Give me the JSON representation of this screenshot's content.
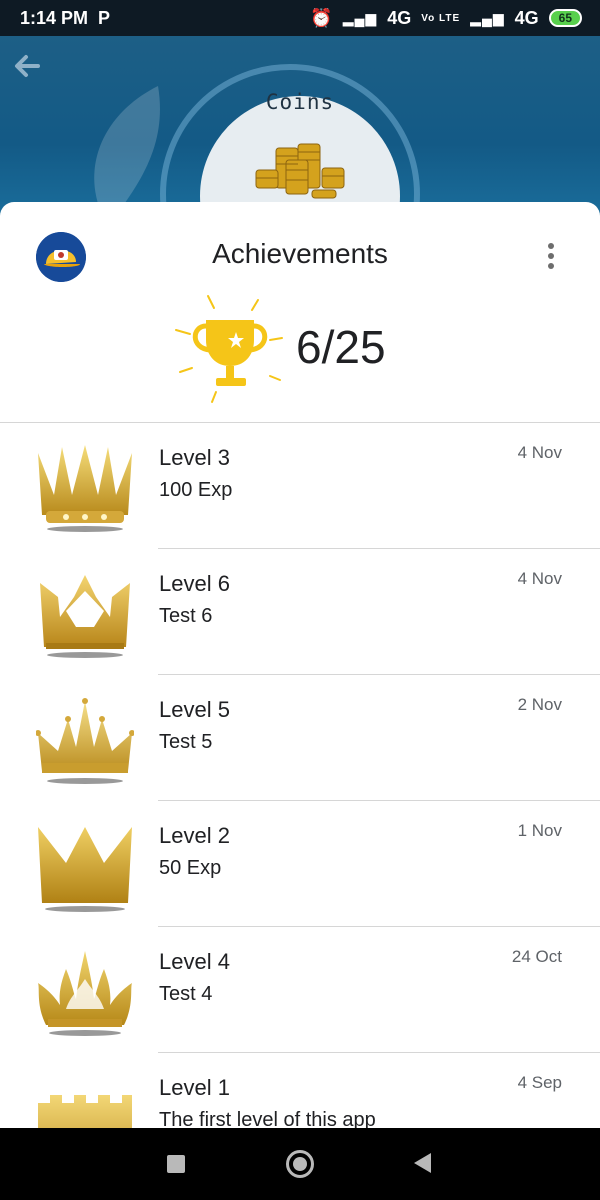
{
  "status_bar": {
    "time": "1:14 PM",
    "app_badge": "P",
    "network_1": "4G",
    "volte": "Vo LTE",
    "network_2": "4G",
    "battery": "65"
  },
  "header": {
    "coins_label": "Coins"
  },
  "sheet": {
    "title": "Achievements",
    "score": "6/25"
  },
  "achievements": [
    {
      "title": "Level 3",
      "subtitle": "100 Exp",
      "date": "4 Nov",
      "icon": "crown-spiked-icon"
    },
    {
      "title": "Level 6",
      "subtitle": "Test 6",
      "date": "4 Nov",
      "icon": "crown-notched-icon"
    },
    {
      "title": "Level 5",
      "subtitle": "Test 5",
      "date": "2 Nov",
      "icon": "crown-pointed-icon"
    },
    {
      "title": "Level 2",
      "subtitle": "50 Exp",
      "date": "1 Nov",
      "icon": "crown-simple-icon"
    },
    {
      "title": "Level 4",
      "subtitle": "Test 4",
      "date": "24 Oct",
      "icon": "crown-ornate-icon"
    },
    {
      "title": "Level 1",
      "subtitle": "The first level of this app",
      "date": "4 Sep",
      "icon": "crown-castle-icon"
    }
  ],
  "colors": {
    "header_blue": "#135a86",
    "gold": "#d9b23a",
    "divider": "#d6d6d6"
  }
}
